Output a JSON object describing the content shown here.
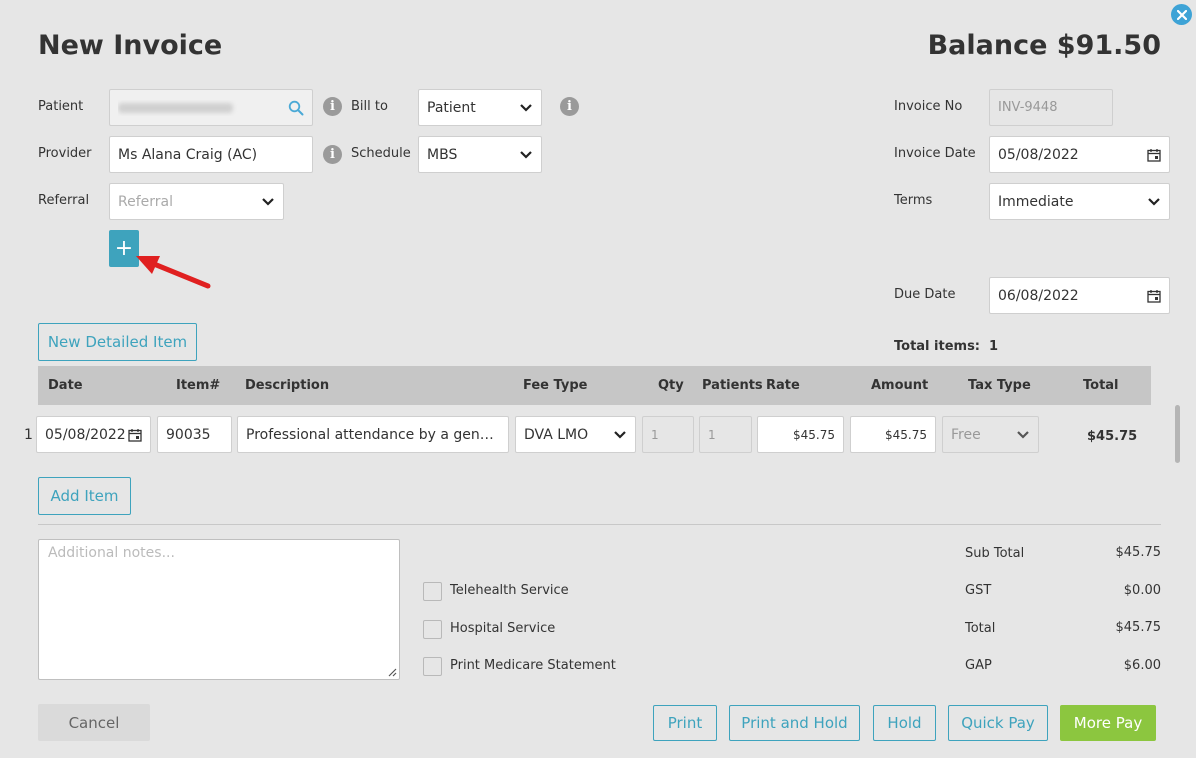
{
  "header": {
    "title": "New Invoice",
    "balance": "Balance $91.50"
  },
  "form": {
    "patient_label": "Patient",
    "provider_label": "Provider",
    "provider_value": "Ms Alana Craig (AC)",
    "referral_label": "Referral",
    "referral_placeholder": "Referral",
    "bill_to_label": "Bill to",
    "bill_to_value": "Patient",
    "schedule_label": "Schedule",
    "schedule_value": "MBS",
    "invoice_no_label": "Invoice No",
    "invoice_no_value": "INV-9448",
    "invoice_date_label": "Invoice Date",
    "invoice_date_value": "05/08/2022",
    "terms_label": "Terms",
    "terms_value": "Immediate",
    "due_date_label": "Due Date",
    "due_date_value": "06/08/2022",
    "add_referral_symbol": "+"
  },
  "actions": {
    "new_detailed_item": "New Detailed Item",
    "add_item": "Add Item",
    "total_items_label": "Total items:",
    "total_items_value": "1"
  },
  "table": {
    "headers": {
      "date": "Date",
      "item": "Item#",
      "description": "Description",
      "fee_type": "Fee Type",
      "qty": "Qty",
      "patients": "Patients",
      "rate": "Rate",
      "amount": "Amount",
      "tax_type": "Tax Type",
      "total": "Total"
    },
    "rows": [
      {
        "num": "1",
        "date": "05/08/2022",
        "item": "90035",
        "description": "Professional attendance by a general practitioner",
        "fee_type": "DVA LMO",
        "qty": "1",
        "patients": "1",
        "rate": "$45.75",
        "amount": "$45.75",
        "tax_type": "Free",
        "total": "$45.75"
      }
    ]
  },
  "notes": {
    "placeholder": "Additional notes..."
  },
  "options": {
    "telehealth": "Telehealth Service",
    "hospital": "Hospital Service",
    "print_medicare": "Print Medicare Statement"
  },
  "summary": {
    "subtotal_label": "Sub Total",
    "subtotal_value": "$45.75",
    "gst_label": "GST",
    "gst_value": "$0.00",
    "total_label": "Total",
    "total_value": "$45.75",
    "gap_label": "GAP",
    "gap_value": "$6.00"
  },
  "footer": {
    "cancel": "Cancel",
    "print": "Print",
    "print_hold": "Print and Hold",
    "hold": "Hold",
    "quick_pay": "Quick Pay",
    "more_pay": "More Pay"
  },
  "colors": {
    "accent": "#3ea3bd",
    "primary_green": "#8cc63f",
    "arrow_red": "#e02020",
    "close_blue": "#3ea3d6"
  },
  "icons": [
    "close-icon",
    "search-icon",
    "info-icon",
    "chevron-down-icon",
    "calendar-icon",
    "plus-icon",
    "resize-grip-icon"
  ]
}
